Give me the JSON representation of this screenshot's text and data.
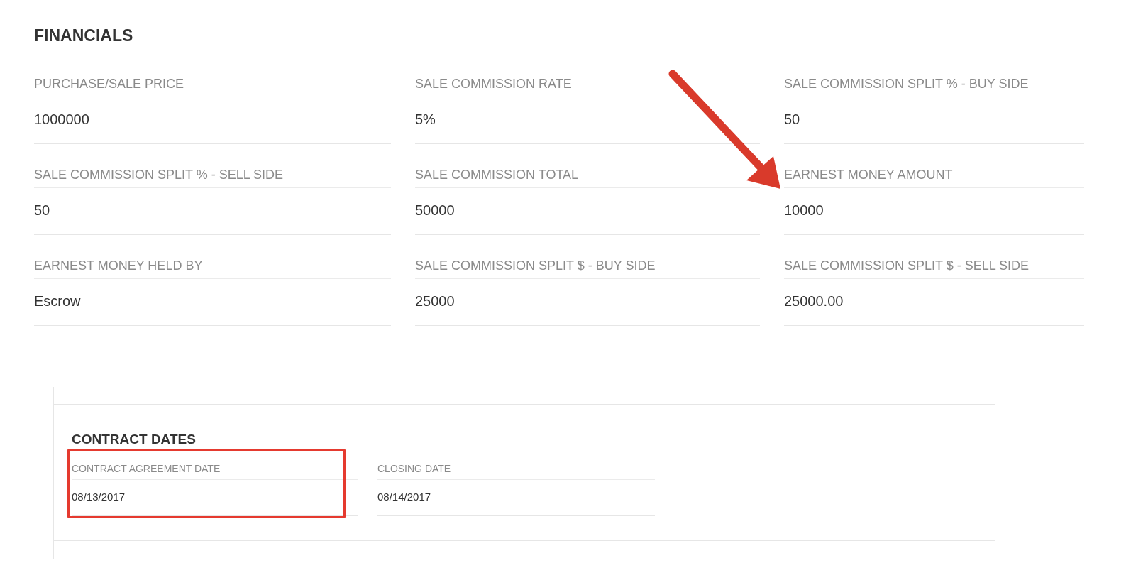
{
  "financials": {
    "title": "FINANCIALS",
    "fields": [
      {
        "label": "PURCHASE/SALE PRICE",
        "value": "1000000",
        "pointed_at": false
      },
      {
        "label": "SALE COMMISSION RATE",
        "value": "5%",
        "pointed_at": false
      },
      {
        "label": "SALE COMMISSION SPLIT % - BUY SIDE",
        "value": "50",
        "pointed_at": false
      },
      {
        "label": "SALE COMMISSION SPLIT % - SELL SIDE",
        "value": "50",
        "pointed_at": false
      },
      {
        "label": "SALE COMMISSION TOTAL",
        "value": "50000",
        "pointed_at": false
      },
      {
        "label": "EARNEST MONEY AMOUNT",
        "value": "10000",
        "pointed_at": true
      },
      {
        "label": "EARNEST MONEY HELD BY",
        "value": "Escrow",
        "pointed_at": false
      },
      {
        "label": "SALE COMMISSION SPLIT $ - BUY SIDE",
        "value": "25000",
        "pointed_at": false
      },
      {
        "label": "SALE COMMISSION SPLIT $ - SELL SIDE",
        "value": "25000.00",
        "pointed_at": false
      }
    ]
  },
  "contract_dates": {
    "title": "CONTRACT DATES",
    "fields": [
      {
        "label": "CONTRACT AGREEMENT DATE",
        "value": "08/13/2017",
        "highlighted": true
      },
      {
        "label": "CLOSING DATE",
        "value": "08/14/2017",
        "highlighted": false
      }
    ]
  }
}
